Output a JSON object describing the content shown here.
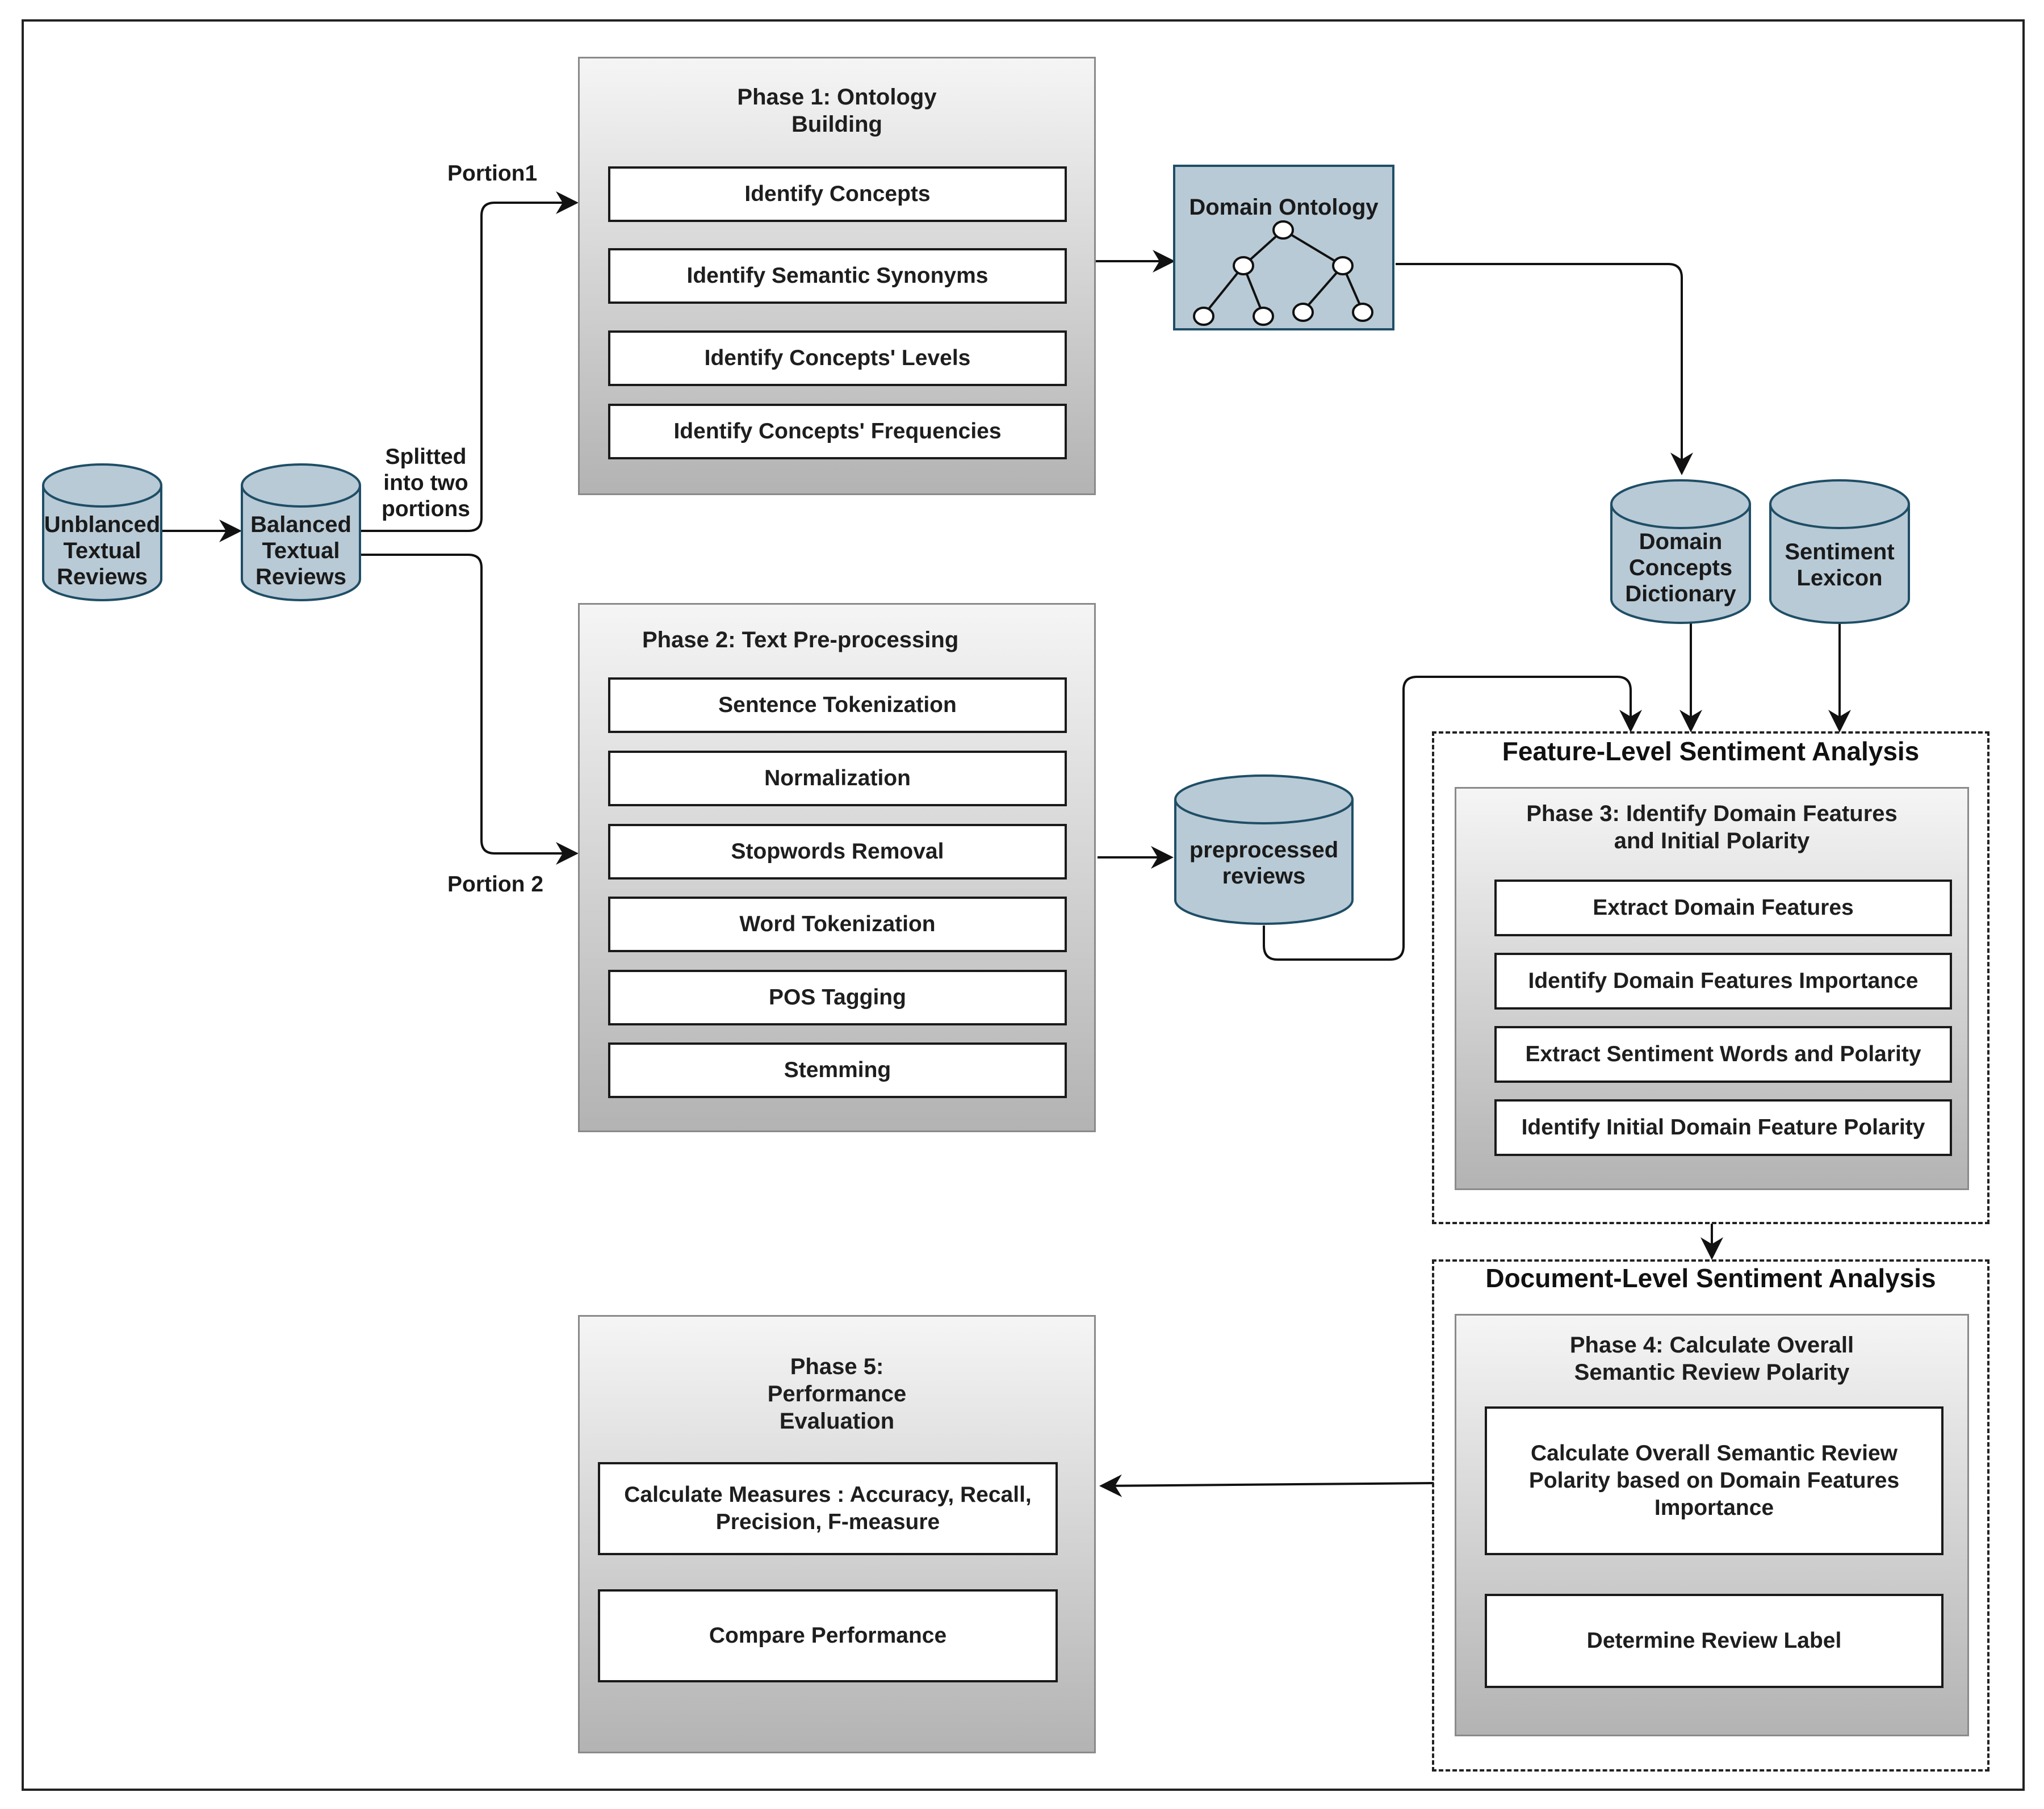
{
  "diagram": {
    "sources": {
      "unbalanced": "Unblanced Textual Reviews",
      "balanced": "Balanced Textual Reviews"
    },
    "edge_labels": {
      "split": "Splitted into two portions",
      "portion1": "Portion1",
      "portion2": "Portion 2"
    },
    "phase1": {
      "title": "Phase 1: Ontology Building",
      "steps": [
        "Identify Concepts",
        "Identify Semantic Synonyms",
        "Identify Concepts' Levels",
        "Identify Concepts' Frequencies"
      ]
    },
    "domain_ontology": {
      "label": "Domain Ontology",
      "icon": "tree-hierarchy-icon"
    },
    "phase2": {
      "title": "Phase 2: Text Pre-processing",
      "steps": [
        "Sentence Tokenization",
        "Normalization",
        "Stopwords Removal",
        "Word Tokenization",
        "POS Tagging",
        "Stemming"
      ]
    },
    "databases": {
      "preprocessed": "preprocessed reviews",
      "dictionary": "Domain Concepts Dictionary",
      "lexicon": "Sentiment Lexicon"
    },
    "feature_level": {
      "title": "Feature-Level Sentiment Analysis",
      "phase3": {
        "title": "Phase 3: Identify Domain Features and Initial Polarity",
        "steps": [
          "Extract Domain Features",
          "Identify Domain Features Importance",
          "Extract Sentiment Words and Polarity",
          "Identify Initial Domain Feature Polarity"
        ]
      }
    },
    "document_level": {
      "title": "Document-Level Sentiment Analysis",
      "phase4": {
        "title": "Phase 4: Calculate Overall Semantic Review Polarity",
        "steps": [
          "Calculate Overall Semantic Review Polarity based on Domain Features Importance",
          "Determine Review Label"
        ]
      }
    },
    "phase5": {
      "title": "Phase 5: Performance Evaluation",
      "steps": [
        "Calculate Measures : Accuracy, Recall, Precision, F-measure",
        "Compare Performance"
      ]
    },
    "colors": {
      "db_fill": "#b8cad6",
      "db_stroke": "#1f4e66",
      "phase_top": "#f5f5f5",
      "phase_bottom": "#b3b3b3"
    }
  }
}
